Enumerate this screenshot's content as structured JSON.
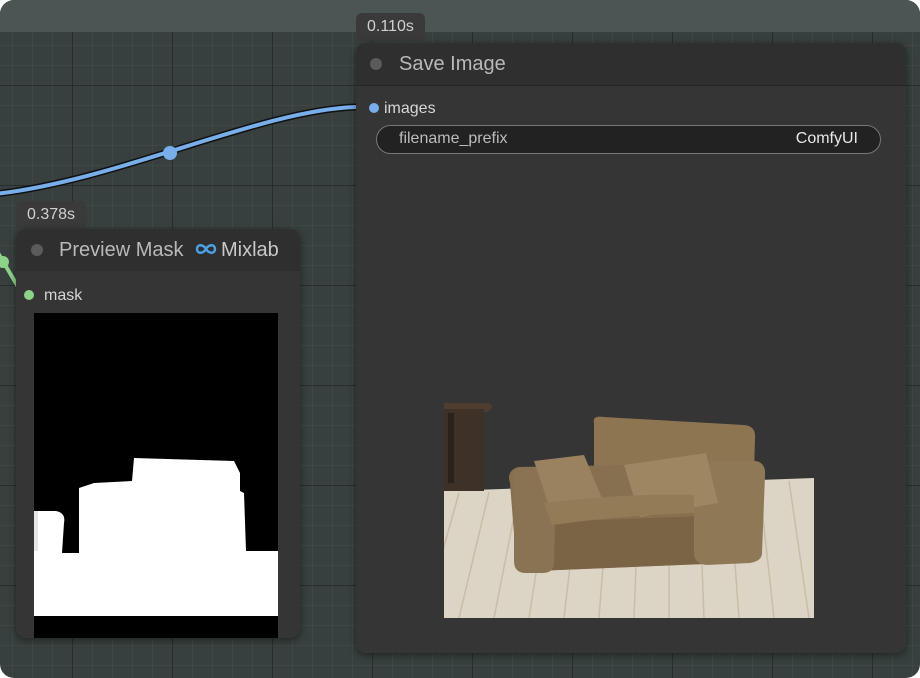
{
  "save_node": {
    "timing": "0.110s",
    "title": "Save Image",
    "input_label": "images",
    "widget": {
      "label": "filename_prefix",
      "value": "ComfyUI"
    }
  },
  "mask_node": {
    "timing": "0.378s",
    "title": "Preview Mask",
    "badge": "Mixlab",
    "input_label": "mask"
  },
  "colors": {
    "canvas_bg": "#37403e",
    "node_bg": "#353535",
    "image_link": "#78aeea",
    "mask_link": "#8ed38a"
  }
}
